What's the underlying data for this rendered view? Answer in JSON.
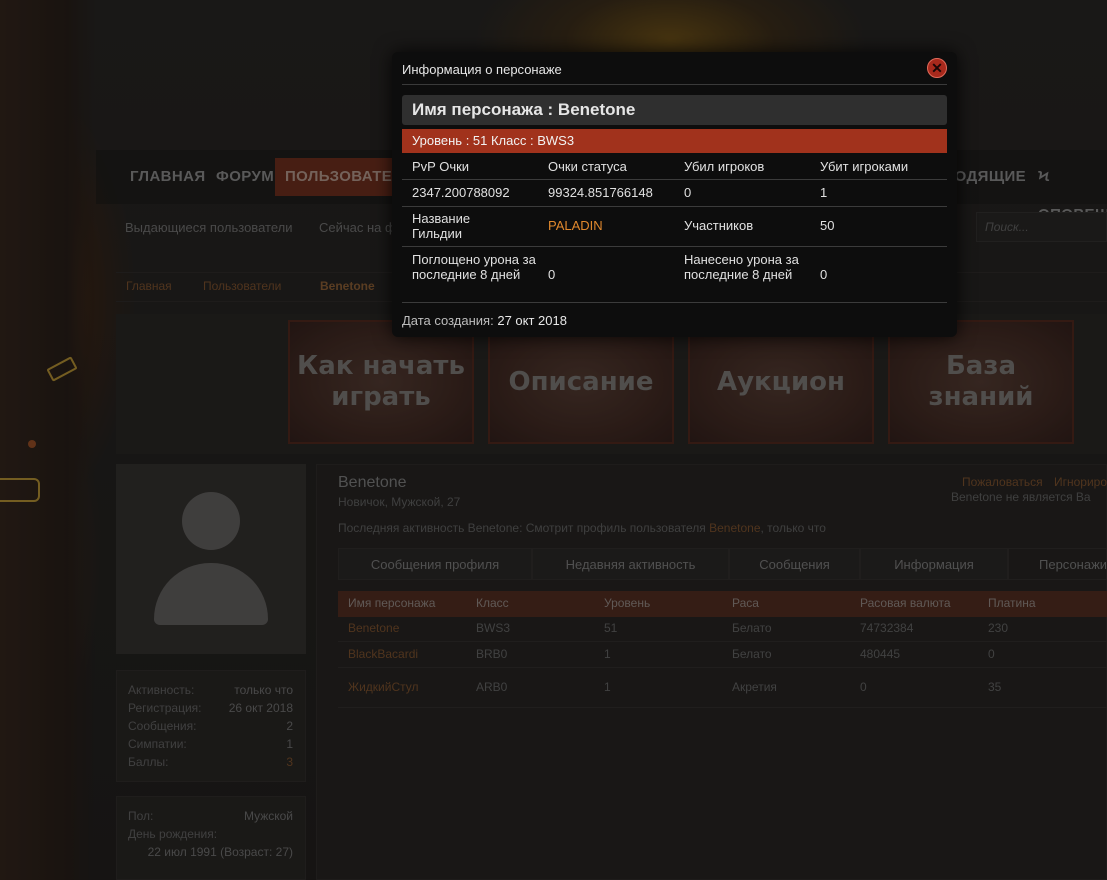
{
  "nav": {
    "items": [
      "ГЛАВНАЯ",
      "ФОРУМ",
      "ПОЛЬЗОВАТЕЛИ",
      "ВХОДЯЩИЕ",
      "ОПОВЕЩ"
    ],
    "active": "ПОЛЬЗОВАТЕЛИ"
  },
  "subnav": [
    "Выдающиеся пользователи",
    "Сейчас на ф"
  ],
  "search": {
    "placeholder": "Поиск..."
  },
  "breadcrumb": [
    "Главная",
    "Пользователи",
    "Benetone"
  ],
  "banners": [
    "Как начать играть",
    "Описание",
    "Аукцион",
    "База знаний"
  ],
  "profile": {
    "name": "Benetone",
    "subtitle": "Новичок, Мужской, 27",
    "activity_prefix": "Последняя активность Benetone: Смотрит профиль пользователя",
    "activity_link": "Benetone",
    "activity_suffix": ", только что",
    "report_link": "Пожаловаться",
    "ignore_link": "Игнориро",
    "note": "Benetone не является Ва"
  },
  "stats": [
    {
      "label": "Активность:",
      "value": "только что"
    },
    {
      "label": "Регистрация:",
      "value": "26 окт 2018"
    },
    {
      "label": "Сообщения:",
      "value": "2"
    },
    {
      "label": "Симпатии:",
      "value": "1"
    },
    {
      "label": "Баллы:",
      "value": "3"
    }
  ],
  "info": {
    "gender_label": "Пол:",
    "gender_value": "Мужской",
    "birthday_label": "День рождения:",
    "birthday_value": "22 июл 1991 (Возраст: 27)"
  },
  "tabs": [
    "Сообщения профиля",
    "Недавняя активность",
    "Сообщения",
    "Информация",
    "Персонажи"
  ],
  "characters": {
    "headers": [
      "Имя персонажа",
      "Класс",
      "Уровень",
      "Раса",
      "Расовая валюта",
      "Платина"
    ],
    "rows": [
      [
        "Benetone",
        "BWS3",
        "51",
        "Белато",
        "74732384",
        "230"
      ],
      [
        "BlackBacardi",
        "BRB0",
        "1",
        "Белато",
        "480445",
        "0"
      ],
      [
        "ЖидкийСтул",
        "ARB0",
        "1",
        "Акретия",
        "0",
        "35"
      ]
    ]
  },
  "modal": {
    "title": "Информация о персонаже",
    "char_name_line": "Имя персонажа : Benetone",
    "level_line": "Уровень : 51 Класс : BWS3",
    "pvp_label": "PvP Очки",
    "status_label": "Очки статуса",
    "kills_label": "Убил игроков",
    "deaths_label": "Убит игроками",
    "pvp_value": "2347.200788092",
    "status_value": "99324.851766148",
    "kills_value": "0",
    "deaths_value": "1",
    "guild_label": "Название Гильдии",
    "guild_value": "PALADIN",
    "members_label": "Участников",
    "members_value": "50",
    "absorbed_label": "Поглощено урона за последние 8 дней",
    "absorbed_value": "0",
    "dealt_label": "Нанесено урона за последние 8 дней",
    "dealt_value": "0",
    "created_label": "Дата создания:",
    "created_value": "27 окт 2018"
  },
  "colors": {
    "accent": "#a1321c",
    "link": "#e0882d",
    "modal_bg": "#0d0d0d"
  }
}
